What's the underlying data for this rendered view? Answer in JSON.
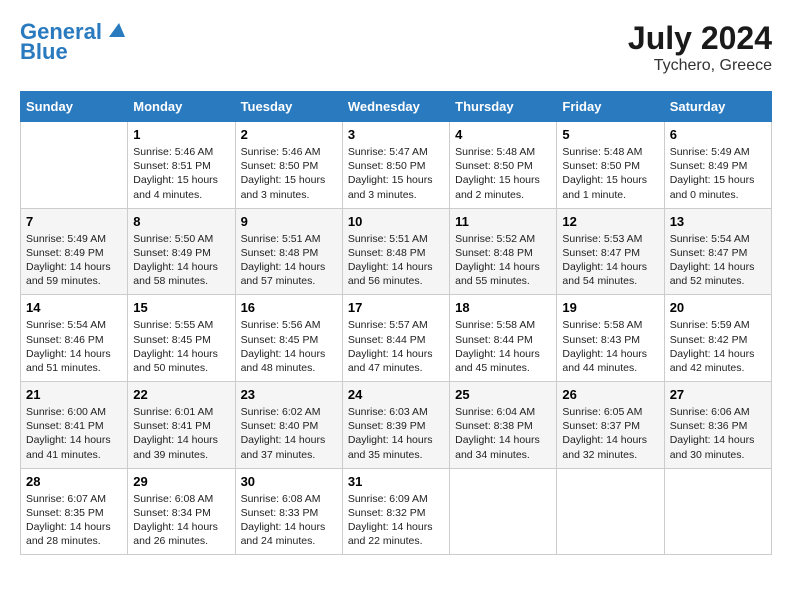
{
  "header": {
    "logo_line1": "General",
    "logo_line2": "Blue",
    "month_year": "July 2024",
    "location": "Tychero, Greece"
  },
  "days_of_week": [
    "Sunday",
    "Monday",
    "Tuesday",
    "Wednesday",
    "Thursday",
    "Friday",
    "Saturday"
  ],
  "weeks": [
    [
      {
        "day": "",
        "sunrise": "",
        "sunset": "",
        "daylight": ""
      },
      {
        "day": "1",
        "sunrise": "5:46 AM",
        "sunset": "8:51 PM",
        "daylight": "15 hours and 4 minutes."
      },
      {
        "day": "2",
        "sunrise": "5:46 AM",
        "sunset": "8:50 PM",
        "daylight": "15 hours and 3 minutes."
      },
      {
        "day": "3",
        "sunrise": "5:47 AM",
        "sunset": "8:50 PM",
        "daylight": "15 hours and 3 minutes."
      },
      {
        "day": "4",
        "sunrise": "5:48 AM",
        "sunset": "8:50 PM",
        "daylight": "15 hours and 2 minutes."
      },
      {
        "day": "5",
        "sunrise": "5:48 AM",
        "sunset": "8:50 PM",
        "daylight": "15 hours and 1 minute."
      },
      {
        "day": "6",
        "sunrise": "5:49 AM",
        "sunset": "8:49 PM",
        "daylight": "15 hours and 0 minutes."
      }
    ],
    [
      {
        "day": "7",
        "sunrise": "5:49 AM",
        "sunset": "8:49 PM",
        "daylight": "14 hours and 59 minutes."
      },
      {
        "day": "8",
        "sunrise": "5:50 AM",
        "sunset": "8:49 PM",
        "daylight": "14 hours and 58 minutes."
      },
      {
        "day": "9",
        "sunrise": "5:51 AM",
        "sunset": "8:48 PM",
        "daylight": "14 hours and 57 minutes."
      },
      {
        "day": "10",
        "sunrise": "5:51 AM",
        "sunset": "8:48 PM",
        "daylight": "14 hours and 56 minutes."
      },
      {
        "day": "11",
        "sunrise": "5:52 AM",
        "sunset": "8:48 PM",
        "daylight": "14 hours and 55 minutes."
      },
      {
        "day": "12",
        "sunrise": "5:53 AM",
        "sunset": "8:47 PM",
        "daylight": "14 hours and 54 minutes."
      },
      {
        "day": "13",
        "sunrise": "5:54 AM",
        "sunset": "8:47 PM",
        "daylight": "14 hours and 52 minutes."
      }
    ],
    [
      {
        "day": "14",
        "sunrise": "5:54 AM",
        "sunset": "8:46 PM",
        "daylight": "14 hours and 51 minutes."
      },
      {
        "day": "15",
        "sunrise": "5:55 AM",
        "sunset": "8:45 PM",
        "daylight": "14 hours and 50 minutes."
      },
      {
        "day": "16",
        "sunrise": "5:56 AM",
        "sunset": "8:45 PM",
        "daylight": "14 hours and 48 minutes."
      },
      {
        "day": "17",
        "sunrise": "5:57 AM",
        "sunset": "8:44 PM",
        "daylight": "14 hours and 47 minutes."
      },
      {
        "day": "18",
        "sunrise": "5:58 AM",
        "sunset": "8:44 PM",
        "daylight": "14 hours and 45 minutes."
      },
      {
        "day": "19",
        "sunrise": "5:58 AM",
        "sunset": "8:43 PM",
        "daylight": "14 hours and 44 minutes."
      },
      {
        "day": "20",
        "sunrise": "5:59 AM",
        "sunset": "8:42 PM",
        "daylight": "14 hours and 42 minutes."
      }
    ],
    [
      {
        "day": "21",
        "sunrise": "6:00 AM",
        "sunset": "8:41 PM",
        "daylight": "14 hours and 41 minutes."
      },
      {
        "day": "22",
        "sunrise": "6:01 AM",
        "sunset": "8:41 PM",
        "daylight": "14 hours and 39 minutes."
      },
      {
        "day": "23",
        "sunrise": "6:02 AM",
        "sunset": "8:40 PM",
        "daylight": "14 hours and 37 minutes."
      },
      {
        "day": "24",
        "sunrise": "6:03 AM",
        "sunset": "8:39 PM",
        "daylight": "14 hours and 35 minutes."
      },
      {
        "day": "25",
        "sunrise": "6:04 AM",
        "sunset": "8:38 PM",
        "daylight": "14 hours and 34 minutes."
      },
      {
        "day": "26",
        "sunrise": "6:05 AM",
        "sunset": "8:37 PM",
        "daylight": "14 hours and 32 minutes."
      },
      {
        "day": "27",
        "sunrise": "6:06 AM",
        "sunset": "8:36 PM",
        "daylight": "14 hours and 30 minutes."
      }
    ],
    [
      {
        "day": "28",
        "sunrise": "6:07 AM",
        "sunset": "8:35 PM",
        "daylight": "14 hours and 28 minutes."
      },
      {
        "day": "29",
        "sunrise": "6:08 AM",
        "sunset": "8:34 PM",
        "daylight": "14 hours and 26 minutes."
      },
      {
        "day": "30",
        "sunrise": "6:08 AM",
        "sunset": "8:33 PM",
        "daylight": "14 hours and 24 minutes."
      },
      {
        "day": "31",
        "sunrise": "6:09 AM",
        "sunset": "8:32 PM",
        "daylight": "14 hours and 22 minutes."
      },
      {
        "day": "",
        "sunrise": "",
        "sunset": "",
        "daylight": ""
      },
      {
        "day": "",
        "sunrise": "",
        "sunset": "",
        "daylight": ""
      },
      {
        "day": "",
        "sunrise": "",
        "sunset": "",
        "daylight": ""
      }
    ]
  ],
  "labels": {
    "sunrise_prefix": "Sunrise: ",
    "sunset_prefix": "Sunset: ",
    "daylight_prefix": "Daylight: "
  }
}
